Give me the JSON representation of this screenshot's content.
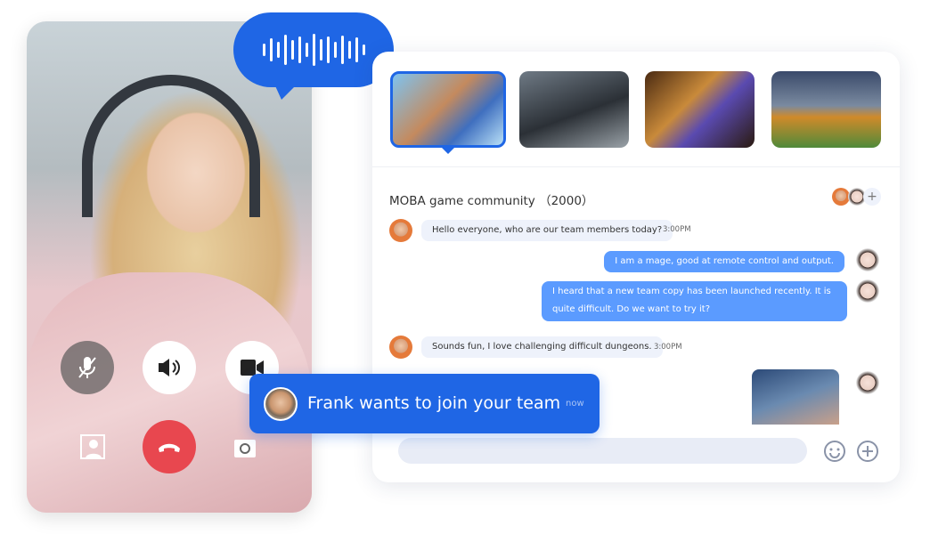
{
  "call": {
    "controls": [
      {
        "name": "mute-mic",
        "icon": "mic-off-icon"
      },
      {
        "name": "speaker",
        "icon": "speaker-icon"
      },
      {
        "name": "camera",
        "icon": "video-camera-icon"
      },
      {
        "name": "background",
        "icon": "virtual-background-icon"
      },
      {
        "name": "hang-up",
        "icon": "phone-hangup-icon"
      },
      {
        "name": "flip-camera",
        "icon": "camera-flip-icon"
      }
    ],
    "hangup_color": "#e8474f"
  },
  "voice_bubble": {
    "icon": "sound-wave-icon",
    "color": "#1f66e5"
  },
  "chat": {
    "title": "MOBA game community （2000）",
    "thumbnails": [
      "moba-game",
      "shooter-game",
      "board-game",
      "soccer-game"
    ],
    "messages": [
      {
        "side": "in",
        "text": "Hello everyone, who are our team members today?",
        "time": "3:00PM"
      },
      {
        "side": "out",
        "text": "I am a mage, good at remote control and output."
      },
      {
        "side": "out",
        "text": "I heard that a new team copy has been launched recently. It is quite difficult. Do we want to try it?"
      },
      {
        "side": "in",
        "text": "Sounds fun, I love challenging difficult dungeons.",
        "time": "3:00PM"
      }
    ],
    "add_member": "+",
    "accent": "#5b9bff"
  },
  "notification": {
    "text": "Frank wants to join your team",
    "time": "now"
  }
}
